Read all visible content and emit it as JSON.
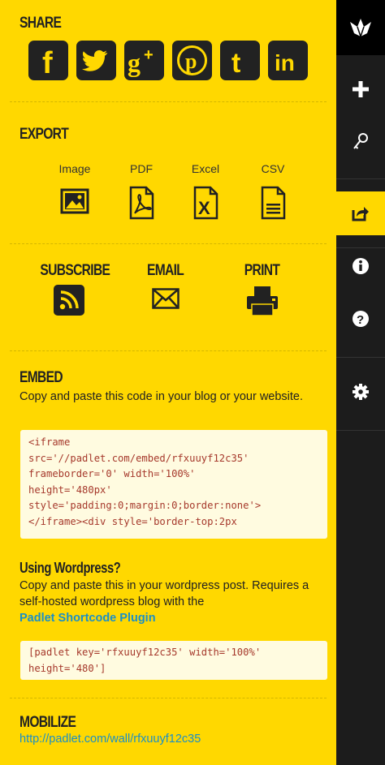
{
  "share": {
    "heading": "SHARE",
    "icons": [
      {
        "name": "facebook-icon",
        "glyph": "f"
      },
      {
        "name": "twitter-icon",
        "glyph": ""
      },
      {
        "name": "google-plus-icon",
        "glyph": "g+"
      },
      {
        "name": "pinterest-icon",
        "glyph": "p"
      },
      {
        "name": "tumblr-icon",
        "glyph": "t"
      },
      {
        "name": "linkedin-icon",
        "glyph": "in"
      }
    ]
  },
  "export": {
    "heading": "EXPORT",
    "items": [
      {
        "label": "Image",
        "icon": "image-icon"
      },
      {
        "label": "PDF",
        "icon": "pdf-icon"
      },
      {
        "label": "Excel",
        "icon": "excel-icon"
      },
      {
        "label": "CSV",
        "icon": "csv-icon"
      }
    ]
  },
  "subscribe": {
    "items": [
      {
        "label": "SUBSCRIBE",
        "icon": "rss-icon"
      },
      {
        "label": "EMAIL",
        "icon": "envelope-icon"
      },
      {
        "label": "PRINT",
        "icon": "printer-icon"
      }
    ]
  },
  "embed": {
    "heading": "EMBED",
    "description": "Copy and paste this code in your blog or your website.",
    "code_lines": [
      "<iframe",
      "src='//padlet.com/embed/rfxuuyf12c35'",
      "frameborder='0' width='100%'",
      "height='480px'",
      "style='padding:0;margin:0;border:none'>",
      "</iframe><div style='border-top:2px"
    ]
  },
  "wordpress": {
    "heading": "Using Wordpress?",
    "description": "Copy and paste this in your wordpress post. Requires a self-hosted wordpress blog with the",
    "link": "Padlet Shortcode Plugin",
    "code_lines": [
      "[padlet key='rfxuuyf12c35' width='100%'",
      "height='480']"
    ]
  },
  "mobilize": {
    "heading": "MOBILIZE",
    "link": "http://padlet.com/wall/rfxuuyf12c35"
  },
  "rail": {
    "items": [
      "padlet-logo-icon",
      "plus-icon",
      "key-icon",
      "share-icon",
      "info-icon",
      "help-icon",
      "gear-icon"
    ]
  },
  "colors": {
    "background": "#ffd800",
    "rail": "#1c1c1c",
    "link": "#1a8fc7",
    "code_text": "#a6392c"
  }
}
